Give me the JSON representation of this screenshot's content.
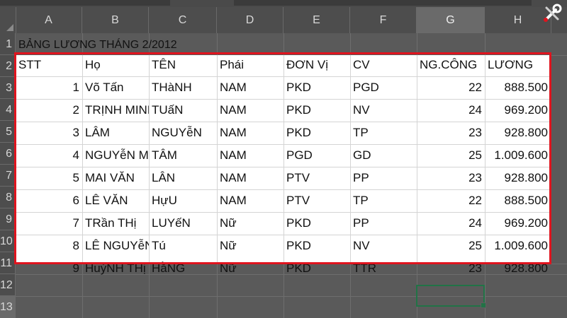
{
  "columns": [
    "A",
    "B",
    "C",
    "D",
    "E",
    "F",
    "G",
    "H"
  ],
  "selected_column": "G",
  "rows": [
    "1",
    "2",
    "3",
    "4",
    "5",
    "6",
    "7",
    "8",
    "9",
    "10",
    "11",
    "12",
    "13"
  ],
  "selected_row": "13",
  "sheet": {
    "title": "BẢNG LƯƠNG THÁNG 2/2012",
    "headers": [
      "STT",
      "Họ",
      "TÊN",
      "Phái",
      "ĐƠN Vị",
      "CV",
      "NG.CÔNG",
      "LƯƠNG"
    ],
    "data": [
      [
        "1",
        "Võ Tấn",
        "THàNH",
        "NAM",
        "PKD",
        "PGD",
        "22",
        "888.500"
      ],
      [
        "2",
        "TRỊNH MINH",
        "TUấN",
        "NAM",
        "PKD",
        "NV",
        "24",
        "969.200"
      ],
      [
        "3",
        "LÂM",
        "NGUYễN",
        "NAM",
        "PKD",
        "TP",
        "23",
        "928.800"
      ],
      [
        "4",
        "NGUYễN MINH",
        "TÂM",
        "NAM",
        "PGD",
        "GD",
        "25",
        "1.009.600"
      ],
      [
        "5",
        "MAI VĂN",
        "LÂN",
        "NAM",
        "PTV",
        "PP",
        "23",
        "928.800"
      ],
      [
        "6",
        "LÊ VĂN",
        "HựU",
        "NAM",
        "PTV",
        "TP",
        "22",
        "888.500"
      ],
      [
        "7",
        "TRần THị",
        "LUYếN",
        "Nữ",
        "PKD",
        "PP",
        "24",
        "969.200"
      ],
      [
        "8",
        "LÊ NGUYễN",
        "Tú",
        "Nữ",
        "PKD",
        "NV",
        "25",
        "1.009.600"
      ],
      [
        "9",
        "HuỳNH THị",
        "HằNG",
        "Nữ",
        "PKD",
        "TTR",
        "23",
        "928.800"
      ]
    ]
  },
  "colors": {
    "highlight_border": "#e0141e",
    "active_cell_border": "#217346",
    "table_background": "#ffffff",
    "dimmed_background": "#5f5f5f"
  },
  "icons": {
    "logo": "tools-logo-icon"
  }
}
